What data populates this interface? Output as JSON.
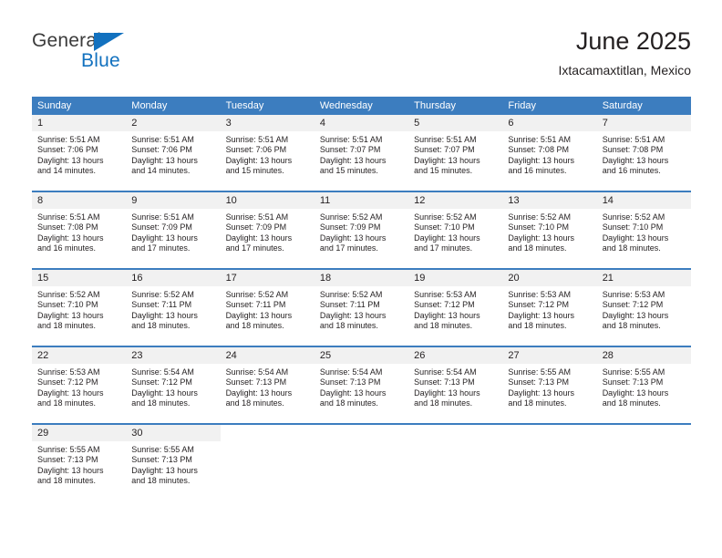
{
  "logo": {
    "word_one": "General",
    "word_two": "Blue",
    "triangle_icon": "blue-triangle-icon",
    "accent_color": "#1271bf"
  },
  "header": {
    "title": "June 2025",
    "subtitle": "Ixtacamaxtitlan, Mexico"
  },
  "theme": {
    "header_blue": "#3c7dbf",
    "daynum_gray": "#f1f1f1",
    "text": "#231f20"
  },
  "calendar": {
    "weekday_headers": [
      "Sunday",
      "Monday",
      "Tuesday",
      "Wednesday",
      "Thursday",
      "Friday",
      "Saturday"
    ],
    "weeks": [
      [
        {
          "day": "1",
          "sunrise": "Sunrise: 5:51 AM",
          "sunset": "Sunset: 7:06 PM",
          "daylight_line1": "Daylight: 13 hours",
          "daylight_line2": "and 14 minutes."
        },
        {
          "day": "2",
          "sunrise": "Sunrise: 5:51 AM",
          "sunset": "Sunset: 7:06 PM",
          "daylight_line1": "Daylight: 13 hours",
          "daylight_line2": "and 14 minutes."
        },
        {
          "day": "3",
          "sunrise": "Sunrise: 5:51 AM",
          "sunset": "Sunset: 7:06 PM",
          "daylight_line1": "Daylight: 13 hours",
          "daylight_line2": "and 15 minutes."
        },
        {
          "day": "4",
          "sunrise": "Sunrise: 5:51 AM",
          "sunset": "Sunset: 7:07 PM",
          "daylight_line1": "Daylight: 13 hours",
          "daylight_line2": "and 15 minutes."
        },
        {
          "day": "5",
          "sunrise": "Sunrise: 5:51 AM",
          "sunset": "Sunset: 7:07 PM",
          "daylight_line1": "Daylight: 13 hours",
          "daylight_line2": "and 15 minutes."
        },
        {
          "day": "6",
          "sunrise": "Sunrise: 5:51 AM",
          "sunset": "Sunset: 7:08 PM",
          "daylight_line1": "Daylight: 13 hours",
          "daylight_line2": "and 16 minutes."
        },
        {
          "day": "7",
          "sunrise": "Sunrise: 5:51 AM",
          "sunset": "Sunset: 7:08 PM",
          "daylight_line1": "Daylight: 13 hours",
          "daylight_line2": "and 16 minutes."
        }
      ],
      [
        {
          "day": "8",
          "sunrise": "Sunrise: 5:51 AM",
          "sunset": "Sunset: 7:08 PM",
          "daylight_line1": "Daylight: 13 hours",
          "daylight_line2": "and 16 minutes."
        },
        {
          "day": "9",
          "sunrise": "Sunrise: 5:51 AM",
          "sunset": "Sunset: 7:09 PM",
          "daylight_line1": "Daylight: 13 hours",
          "daylight_line2": "and 17 minutes."
        },
        {
          "day": "10",
          "sunrise": "Sunrise: 5:51 AM",
          "sunset": "Sunset: 7:09 PM",
          "daylight_line1": "Daylight: 13 hours",
          "daylight_line2": "and 17 minutes."
        },
        {
          "day": "11",
          "sunrise": "Sunrise: 5:52 AM",
          "sunset": "Sunset: 7:09 PM",
          "daylight_line1": "Daylight: 13 hours",
          "daylight_line2": "and 17 minutes."
        },
        {
          "day": "12",
          "sunrise": "Sunrise: 5:52 AM",
          "sunset": "Sunset: 7:10 PM",
          "daylight_line1": "Daylight: 13 hours",
          "daylight_line2": "and 17 minutes."
        },
        {
          "day": "13",
          "sunrise": "Sunrise: 5:52 AM",
          "sunset": "Sunset: 7:10 PM",
          "daylight_line1": "Daylight: 13 hours",
          "daylight_line2": "and 18 minutes."
        },
        {
          "day": "14",
          "sunrise": "Sunrise: 5:52 AM",
          "sunset": "Sunset: 7:10 PM",
          "daylight_line1": "Daylight: 13 hours",
          "daylight_line2": "and 18 minutes."
        }
      ],
      [
        {
          "day": "15",
          "sunrise": "Sunrise: 5:52 AM",
          "sunset": "Sunset: 7:10 PM",
          "daylight_line1": "Daylight: 13 hours",
          "daylight_line2": "and 18 minutes."
        },
        {
          "day": "16",
          "sunrise": "Sunrise: 5:52 AM",
          "sunset": "Sunset: 7:11 PM",
          "daylight_line1": "Daylight: 13 hours",
          "daylight_line2": "and 18 minutes."
        },
        {
          "day": "17",
          "sunrise": "Sunrise: 5:52 AM",
          "sunset": "Sunset: 7:11 PM",
          "daylight_line1": "Daylight: 13 hours",
          "daylight_line2": "and 18 minutes."
        },
        {
          "day": "18",
          "sunrise": "Sunrise: 5:52 AM",
          "sunset": "Sunset: 7:11 PM",
          "daylight_line1": "Daylight: 13 hours",
          "daylight_line2": "and 18 minutes."
        },
        {
          "day": "19",
          "sunrise": "Sunrise: 5:53 AM",
          "sunset": "Sunset: 7:12 PM",
          "daylight_line1": "Daylight: 13 hours",
          "daylight_line2": "and 18 minutes."
        },
        {
          "day": "20",
          "sunrise": "Sunrise: 5:53 AM",
          "sunset": "Sunset: 7:12 PM",
          "daylight_line1": "Daylight: 13 hours",
          "daylight_line2": "and 18 minutes."
        },
        {
          "day": "21",
          "sunrise": "Sunrise: 5:53 AM",
          "sunset": "Sunset: 7:12 PM",
          "daylight_line1": "Daylight: 13 hours",
          "daylight_line2": "and 18 minutes."
        }
      ],
      [
        {
          "day": "22",
          "sunrise": "Sunrise: 5:53 AM",
          "sunset": "Sunset: 7:12 PM",
          "daylight_line1": "Daylight: 13 hours",
          "daylight_line2": "and 18 minutes."
        },
        {
          "day": "23",
          "sunrise": "Sunrise: 5:54 AM",
          "sunset": "Sunset: 7:12 PM",
          "daylight_line1": "Daylight: 13 hours",
          "daylight_line2": "and 18 minutes."
        },
        {
          "day": "24",
          "sunrise": "Sunrise: 5:54 AM",
          "sunset": "Sunset: 7:13 PM",
          "daylight_line1": "Daylight: 13 hours",
          "daylight_line2": "and 18 minutes."
        },
        {
          "day": "25",
          "sunrise": "Sunrise: 5:54 AM",
          "sunset": "Sunset: 7:13 PM",
          "daylight_line1": "Daylight: 13 hours",
          "daylight_line2": "and 18 minutes."
        },
        {
          "day": "26",
          "sunrise": "Sunrise: 5:54 AM",
          "sunset": "Sunset: 7:13 PM",
          "daylight_line1": "Daylight: 13 hours",
          "daylight_line2": "and 18 minutes."
        },
        {
          "day": "27",
          "sunrise": "Sunrise: 5:55 AM",
          "sunset": "Sunset: 7:13 PM",
          "daylight_line1": "Daylight: 13 hours",
          "daylight_line2": "and 18 minutes."
        },
        {
          "day": "28",
          "sunrise": "Sunrise: 5:55 AM",
          "sunset": "Sunset: 7:13 PM",
          "daylight_line1": "Daylight: 13 hours",
          "daylight_line2": "and 18 minutes."
        }
      ],
      [
        {
          "day": "29",
          "sunrise": "Sunrise: 5:55 AM",
          "sunset": "Sunset: 7:13 PM",
          "daylight_line1": "Daylight: 13 hours",
          "daylight_line2": "and 18 minutes."
        },
        {
          "day": "30",
          "sunrise": "Sunrise: 5:55 AM",
          "sunset": "Sunset: 7:13 PM",
          "daylight_line1": "Daylight: 13 hours",
          "daylight_line2": "and 18 minutes."
        },
        {
          "day": "",
          "sunrise": "",
          "sunset": "",
          "daylight_line1": "",
          "daylight_line2": ""
        },
        {
          "day": "",
          "sunrise": "",
          "sunset": "",
          "daylight_line1": "",
          "daylight_line2": ""
        },
        {
          "day": "",
          "sunrise": "",
          "sunset": "",
          "daylight_line1": "",
          "daylight_line2": ""
        },
        {
          "day": "",
          "sunrise": "",
          "sunset": "",
          "daylight_line1": "",
          "daylight_line2": ""
        },
        {
          "day": "",
          "sunrise": "",
          "sunset": "",
          "daylight_line1": "",
          "daylight_line2": ""
        }
      ]
    ]
  }
}
